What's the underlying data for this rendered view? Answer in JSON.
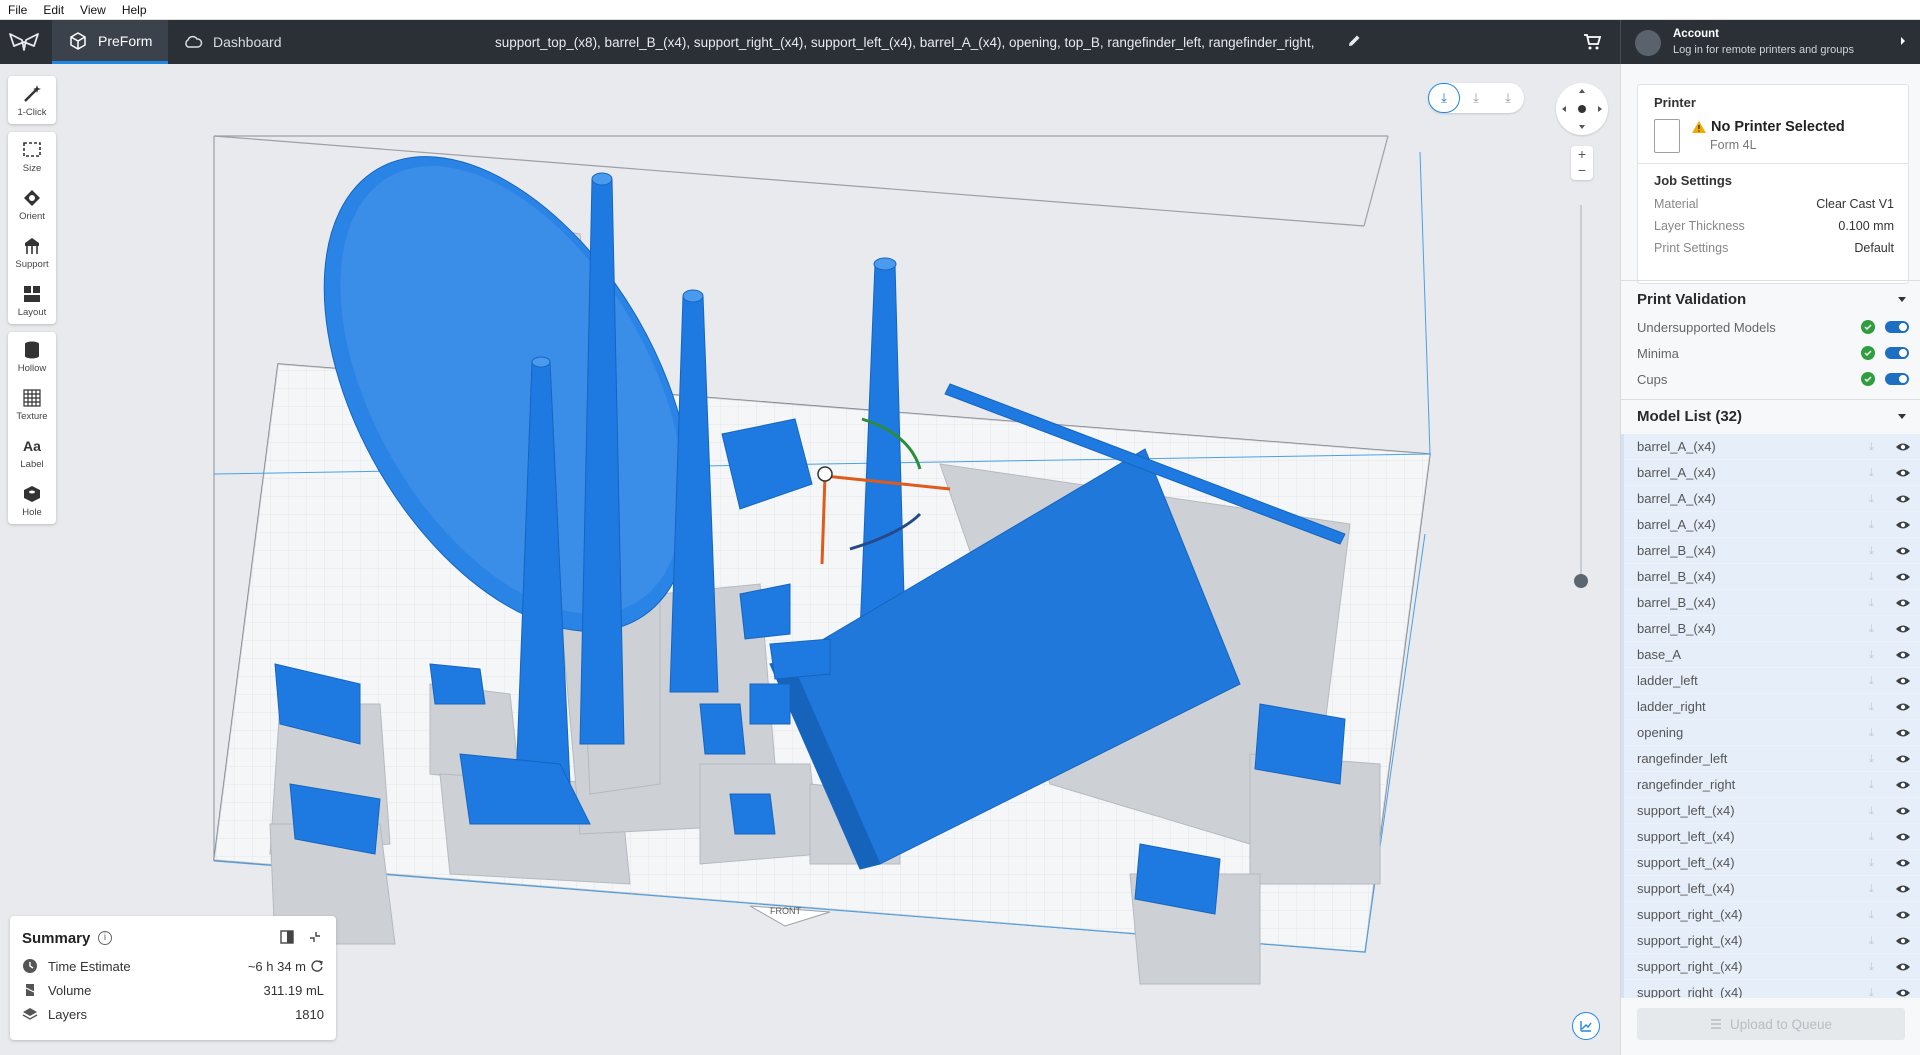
{
  "menu": [
    "File",
    "Edit",
    "View",
    "Help"
  ],
  "appbar": {
    "tabs": [
      {
        "label": "PreForm",
        "active": true
      },
      {
        "label": "Dashboard",
        "active": false
      }
    ],
    "job_title": "support_top_(x8), barrel_B_(x4), support_right_(x4), support_left_(x4), barrel_A_(x4), opening, top_B, rangefinder_left, rangefinder_right,",
    "account_title": "Account",
    "account_subtitle": "Log in for remote printers and groups"
  },
  "toolbar": {
    "group1": [
      {
        "label": "1-Click",
        "icon": "wand-icon"
      }
    ],
    "group2": [
      {
        "label": "Size",
        "icon": "size-icon"
      },
      {
        "label": "Orient",
        "icon": "orient-icon"
      },
      {
        "label": "Support",
        "icon": "support-icon"
      },
      {
        "label": "Layout",
        "icon": "layout-icon"
      }
    ],
    "group3": [
      {
        "label": "Hollow",
        "icon": "hollow-icon"
      },
      {
        "label": "Texture",
        "icon": "texture-icon"
      },
      {
        "label": "Label",
        "icon": "label-icon"
      },
      {
        "label": "Hole",
        "icon": "hole-icon"
      }
    ]
  },
  "viewport": {
    "front_label": "FRONT",
    "zoom_in": "+",
    "zoom_out": "−",
    "accent_color": "#1e7ae0"
  },
  "summary": {
    "title": "Summary",
    "rows": [
      {
        "label": "Time Estimate",
        "value": "~6 h 34 m"
      },
      {
        "label": "Volume",
        "value": "311.19 mL"
      },
      {
        "label": "Layers",
        "value": "1810"
      }
    ]
  },
  "printer": {
    "section": "Printer",
    "status": "No Printer Selected",
    "model": "Form 4L",
    "job_settings_title": "Job Settings",
    "settings": [
      {
        "key": "Material",
        "value": "Clear Cast V1"
      },
      {
        "key": "Layer Thickness",
        "value": "0.100 mm"
      },
      {
        "key": "Print Settings",
        "value": "Default"
      }
    ]
  },
  "validation": {
    "title": "Print Validation",
    "items": [
      {
        "label": "Undersupported Models",
        "enabled": true
      },
      {
        "label": "Minima",
        "enabled": true
      },
      {
        "label": "Cups",
        "enabled": true
      }
    ]
  },
  "models": {
    "title": "Model List (32)",
    "items": [
      "barrel_A_(x4)",
      "barrel_A_(x4)",
      "barrel_A_(x4)",
      "barrel_A_(x4)",
      "barrel_B_(x4)",
      "barrel_B_(x4)",
      "barrel_B_(x4)",
      "barrel_B_(x4)",
      "base_A",
      "ladder_left",
      "ladder_right",
      "opening",
      "rangefinder_left",
      "rangefinder_right",
      "support_left_(x4)",
      "support_left_(x4)",
      "support_left_(x4)",
      "support_left_(x4)",
      "support_right_(x4)",
      "support_right_(x4)",
      "support_right_(x4)",
      "support_right_(x4)"
    ]
  },
  "upload_button": "Upload to Queue"
}
